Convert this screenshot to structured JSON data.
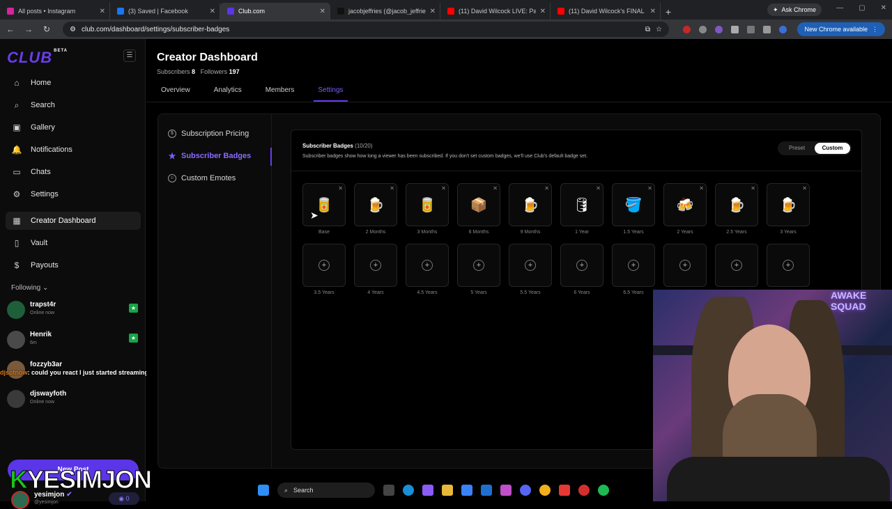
{
  "browser": {
    "tabs": [
      {
        "title": "All posts • Instagram",
        "color": "#d6249f",
        "active": false
      },
      {
        "title": "(3) Saved | Facebook",
        "color": "#1877f2",
        "active": false
      },
      {
        "title": "Club.com",
        "color": "#5b35e8",
        "active": true
      },
      {
        "title": "jacobjeffries (@jacob_jeffries) |",
        "color": "#111111",
        "active": false
      },
      {
        "title": "(11) David Wilcock LIVE: Pathw",
        "color": "#ff0000",
        "active": false
      },
      {
        "title": "(11) David Wilcock's FINAL 72 I",
        "color": "#ff0000",
        "active": false
      }
    ],
    "new_tab": "+",
    "ask_chrome": "Ask Chrome",
    "url": "club.com/dashboard/settings/subscriber-badges",
    "new_chrome": "New Chrome available"
  },
  "sidebar": {
    "logo": "CLUB",
    "logo_badge": "BETA",
    "items": [
      {
        "label": "Home",
        "icon": "home-icon",
        "glyph": "⌂"
      },
      {
        "label": "Search",
        "icon": "search-icon",
        "glyph": "⌕"
      },
      {
        "label": "Gallery",
        "icon": "gallery-icon",
        "glyph": "▣"
      },
      {
        "label": "Notifications",
        "icon": "bell-icon",
        "glyph": "🔔"
      },
      {
        "label": "Chats",
        "icon": "chat-icon",
        "glyph": "▭"
      },
      {
        "label": "Settings",
        "icon": "gear-icon",
        "glyph": "⚙"
      },
      {
        "label": "Creator Dashboard",
        "icon": "dashboard-icon",
        "glyph": "▦"
      },
      {
        "label": "Vault",
        "icon": "vault-icon",
        "glyph": "▯"
      },
      {
        "label": "Payouts",
        "icon": "payouts-icon",
        "glyph": "$"
      }
    ],
    "following_label": "Following",
    "following": [
      {
        "name": "trapst4r",
        "status": "Online now"
      },
      {
        "name": "Henrik",
        "status": "6m"
      },
      {
        "name": "fozzyb3ar",
        "status": ""
      },
      {
        "name": "djswayfoth",
        "status": "Online now"
      }
    ],
    "new_post": "New Post",
    "profile": {
      "name": "yesimjon",
      "handle": "@yesimjon",
      "count": "0"
    }
  },
  "overlay": {
    "chat_user": "djsotnow",
    "chat_text": ": could you react I just started streaming",
    "streamer_k": "K",
    "streamer_name": "YESIMJON"
  },
  "main": {
    "title": "Creator Dashboard",
    "subscribers_label": "Subscribers",
    "subscribers_value": "8",
    "followers_label": "Followers",
    "followers_value": "197",
    "tabs": [
      "Overview",
      "Analytics",
      "Members",
      "Settings"
    ],
    "active_tab": 3,
    "settings_menu": [
      {
        "label": "Subscription Pricing",
        "glyph": "$"
      },
      {
        "label": "Subscriber Badges",
        "glyph": "★"
      },
      {
        "label": "Custom Emotes",
        "glyph": "☺"
      }
    ],
    "badges": {
      "title": "Subscriber Badges",
      "count": "(10/20)",
      "description": "Subscriber badges show how long a viewer has been subscribed. If you don't set custom badges, we'll use Club's default badge set.",
      "toggle_preset": "Preset",
      "toggle_custom": "Custom",
      "filled": [
        {
          "label": "Base",
          "emoji": "🥫"
        },
        {
          "label": "2 Months",
          "emoji": "🍺"
        },
        {
          "label": "3 Months",
          "emoji": "🥫"
        },
        {
          "label": "6 Months",
          "emoji": "📦"
        },
        {
          "label": "9 Months",
          "emoji": "🍺"
        },
        {
          "label": "1 Year",
          "emoji": "🛢"
        },
        {
          "label": "1.5 Years",
          "emoji": "🪣"
        },
        {
          "label": "2 Years",
          "emoji": "🍻"
        },
        {
          "label": "2.5 Years",
          "emoji": "🍺"
        },
        {
          "label": "3 Years",
          "emoji": "🍺"
        }
      ],
      "empty": [
        "3.5 Years",
        "4 Years",
        "4.5 Years",
        "5 Years",
        "5.5 Years",
        "6 Years",
        "6.5 Years",
        "",
        "",
        ""
      ]
    }
  },
  "webcam": {
    "sign": "AWAKE SQUAD"
  },
  "taskbar": {
    "search": "Search"
  }
}
